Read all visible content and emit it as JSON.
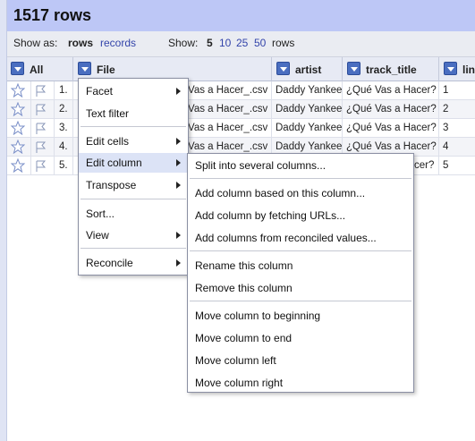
{
  "header": {
    "title": "1517 rows"
  },
  "toolbar": {
    "show_as_label": "Show as:",
    "rows_label": "rows",
    "records_label": "records",
    "show_label": "Show:",
    "page_sizes": [
      "5",
      "10",
      "25",
      "50"
    ],
    "rows_suffix": "rows"
  },
  "columns": {
    "all": "All",
    "file": "File",
    "artist": "artist",
    "track_title": "track_title",
    "line": "line"
  },
  "rows": [
    {
      "num": "1.",
      "file": "Vas a Hacer_.csv",
      "artist": "Daddy Yankee",
      "track_title": "¿Qué Vas a Hacer?",
      "line": "1"
    },
    {
      "num": "2.",
      "file": "Vas a Hacer_.csv",
      "artist": "Daddy Yankee",
      "track_title": "¿Qué Vas a Hacer?",
      "line": "2"
    },
    {
      "num": "3.",
      "file": "Vas a Hacer_.csv",
      "artist": "Daddy Yankee",
      "track_title": "¿Qué Vas a Hacer?",
      "line": "3"
    },
    {
      "num": "4.",
      "file": "Vas a Hacer_.csv",
      "artist": "Daddy Yankee",
      "track_title": "¿Qué Vas a Hacer?",
      "line": "4"
    },
    {
      "num": "5.",
      "file": "",
      "artist": "",
      "track_title": "cer?",
      "line": "5"
    }
  ],
  "column_menu": {
    "facet": "Facet",
    "text_filter": "Text filter",
    "edit_cells": "Edit cells",
    "edit_column": "Edit column",
    "transpose": "Transpose",
    "sort": "Sort...",
    "view": "View",
    "reconcile": "Reconcile"
  },
  "edit_column_menu": {
    "split": "Split into several columns...",
    "add_based": "Add column based on this column...",
    "add_fetch": "Add column by fetching URLs...",
    "add_reconciled": "Add columns from reconciled values...",
    "rename": "Rename this column",
    "remove": "Remove this column",
    "move_begin": "Move column to beginning",
    "move_end": "Move column to end",
    "move_left": "Move column left",
    "move_right": "Move column right"
  },
  "colors": {
    "title_bar": "#bdc7f6",
    "link": "#3344aa",
    "dropdown": "#4a6ec0",
    "highlight": "#dce3f6"
  }
}
